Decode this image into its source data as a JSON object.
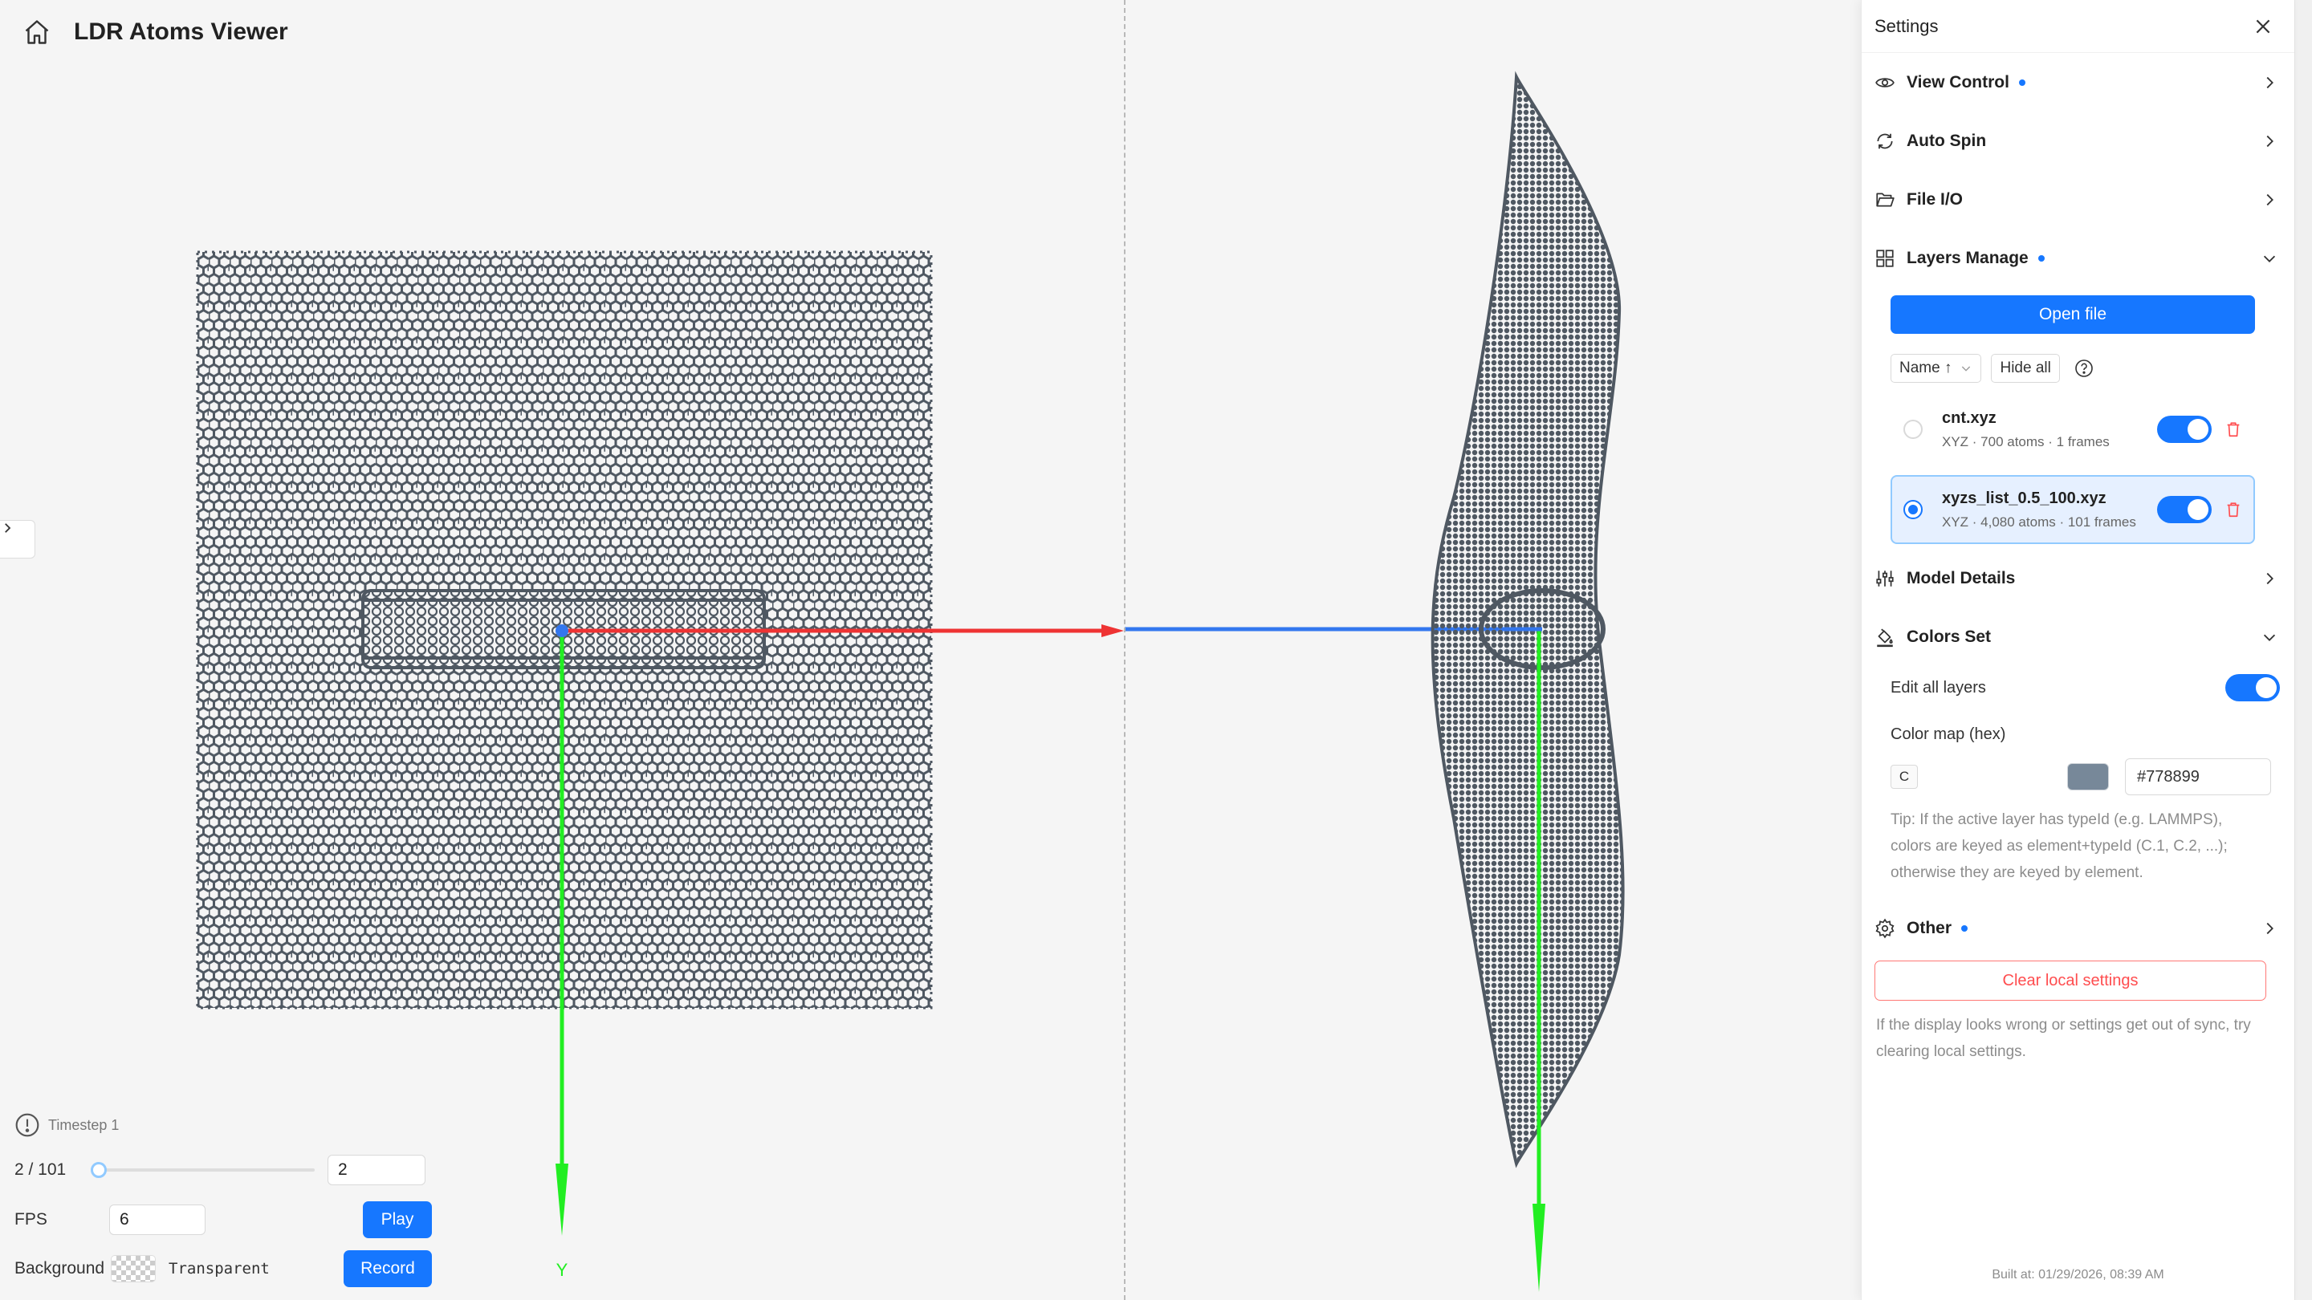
{
  "app": {
    "title": "LDR Atoms Viewer"
  },
  "viewport": {
    "left": {
      "y_axis_label": "Y"
    },
    "axis_colors": {
      "x": "#ee3333",
      "y": "#22ee22",
      "z": "#3377ee"
    },
    "atom_color": "#4f5862"
  },
  "playback": {
    "timestep_label": "Timestep 1",
    "frame_label": "2 / 101",
    "frame_current": 2,
    "frame_total": 101,
    "frame_input_value": "2",
    "fps_label": "FPS",
    "fps_value": "6",
    "play_label": "Play",
    "background_label": "Background",
    "background_value": "Transparent",
    "record_label": "Record"
  },
  "settings": {
    "title": "Settings",
    "sections": {
      "view_control": {
        "label": "View Control",
        "has_dot": true
      },
      "auto_spin": {
        "label": "Auto Spin"
      },
      "file_io": {
        "label": "File I/O"
      },
      "layers_manage": {
        "label": "Layers Manage",
        "has_dot": true
      },
      "model_details": {
        "label": "Model Details"
      },
      "colors_set": {
        "label": "Colors Set"
      },
      "other": {
        "label": "Other",
        "has_dot": true
      }
    },
    "layers": {
      "open_file_label": "Open file",
      "sort_label": "Name ↑",
      "hide_all_label": "Hide all",
      "items": [
        {
          "name": "cnt.xyz",
          "meta": "XYZ · 700 atoms · 1 frames",
          "active": false,
          "visible": true
        },
        {
          "name": "xyzs_list_0.5_100.xyz",
          "meta": "XYZ · 4,080 atoms · 101 frames",
          "active": true,
          "visible": true
        }
      ]
    },
    "colors": {
      "edit_all_label": "Edit all layers",
      "color_map_label": "Color map (hex)",
      "element": "C",
      "hex_value": "#778899",
      "tip": "Tip: If the active layer has typeId (e.g. LAMMPS), colors are keyed as element+typeId (C.1, C.2, ...); otherwise they are keyed by element."
    },
    "clear_label": "Clear local settings",
    "clear_note": "If the display looks wrong or settings get out of sync, try clearing local settings.",
    "built_at": "Built at: 01/29/2026, 08:39 AM"
  }
}
